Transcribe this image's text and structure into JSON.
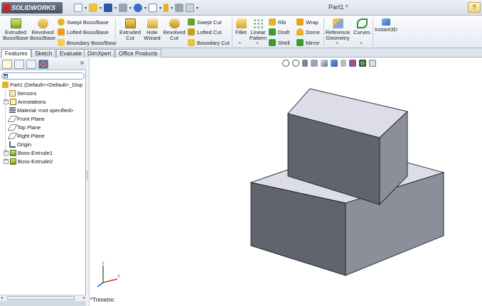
{
  "app": {
    "logo_text": "SOLIDWORKS",
    "doc_title": "Part1 *",
    "help_icon": "?"
  },
  "quick_access": [
    {
      "name": "new-document-icon",
      "color": "#f4f6fa"
    },
    {
      "name": "open-folder-icon",
      "color": "#e9c247"
    },
    {
      "name": "save-icon",
      "color": "#2d56a8"
    },
    {
      "name": "print-icon",
      "color": "#9aa3b2"
    },
    {
      "name": "undo-icon",
      "color": "#3a6fc2"
    },
    {
      "name": "select-arrow-icon",
      "color": "#ffffff"
    },
    {
      "name": "rebuild-icon",
      "color": "#e3b427"
    },
    {
      "name": "options-icon",
      "color": "#9aa3b2"
    }
  ],
  "ribbon": {
    "extruded_boss": "Extruded Boss/Base",
    "revolved_boss": "Revolved Boss/Base",
    "swept_boss": "Swept Boss/Base",
    "lofted_boss": "Lofted Boss/Base",
    "boundary_boss": "Boundary Boss/Base",
    "extruded_cut": "Extruded Cut",
    "hole_wizard": "Hole Wizard",
    "revolved_cut": "Revolved Cut",
    "swept_cut": "Swept Cut",
    "lofted_cut": "Lofted Cut",
    "boundary_cut": "Boundary Cut",
    "fillet": "Fillet",
    "linear_pattern": "Linear Pattern",
    "rib": "Rib",
    "draft": "Draft",
    "shell": "Shell",
    "wrap": "Wrap",
    "dome": "Dome",
    "mirror": "Mirror",
    "reference_geometry": "Reference Geometry",
    "curves": "Curves",
    "instant3d": "Instant3D"
  },
  "tabs": [
    {
      "label": "Features",
      "active": true
    },
    {
      "label": "Sketch",
      "active": false
    },
    {
      "label": "Evaluate",
      "active": false
    },
    {
      "label": "DimXpert",
      "active": false
    },
    {
      "label": "Office Products",
      "active": false
    }
  ],
  "feature_manager": {
    "more": "»",
    "tree": [
      {
        "label": "Part1  (Default<<Default>_Disp",
        "icon": "part-icon"
      },
      {
        "label": "Sensors",
        "icon": "sensors-icon"
      },
      {
        "label": "Annotations",
        "icon": "annotations-icon"
      },
      {
        "label": "Material <not specified>",
        "icon": "material-icon"
      },
      {
        "label": "Front Plane",
        "icon": "plane-icon"
      },
      {
        "label": "Top Plane",
        "icon": "plane-icon"
      },
      {
        "label": "Right Plane",
        "icon": "plane-icon"
      },
      {
        "label": "Origin",
        "icon": "origin-icon"
      },
      {
        "label": "Boss-Extrude1",
        "icon": "extrude-icon"
      },
      {
        "label": "Boss-Extrude2",
        "icon": "extrude-icon"
      }
    ],
    "expander_plus": "+",
    "scroll_left": "◂",
    "scroll_right": "▸"
  },
  "viewport": {
    "view_name": "*Trimetric",
    "axis_x": "X",
    "axis_y": "Y",
    "colors": {
      "top_face": "#dcdde8",
      "front_face": "#60646e",
      "side_face": "#8a8f99",
      "edge": "#1e1e24"
    }
  }
}
